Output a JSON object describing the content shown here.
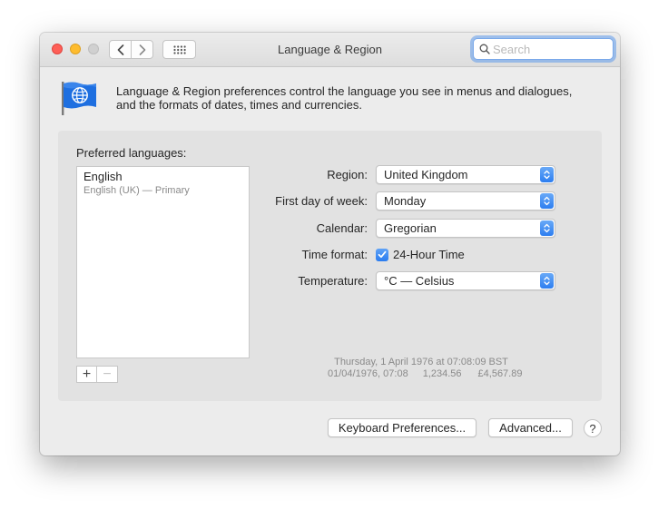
{
  "window": {
    "title": "Language & Region",
    "search_placeholder": "Search"
  },
  "description": {
    "line1": "Language & Region preferences control the language you see in menus and dialogues,",
    "line2": "and the formats of dates, times and currencies."
  },
  "preferred_languages": {
    "label": "Preferred languages:",
    "items": [
      {
        "name": "English",
        "subtitle": "English (UK) — Primary"
      }
    ],
    "add_label": "+",
    "remove_label": "−"
  },
  "settings": {
    "region": {
      "label": "Region:",
      "value": "United Kingdom"
    },
    "first_day": {
      "label": "First day of week:",
      "value": "Monday"
    },
    "calendar": {
      "label": "Calendar:",
      "value": "Gregorian"
    },
    "time_format": {
      "label": "Time format:",
      "checkbox_label": "24-Hour Time",
      "checked": true
    },
    "temperature": {
      "label": "Temperature:",
      "value": "°C — Celsius"
    }
  },
  "sample": {
    "line1": "Thursday, 1 April 1976 at 07:08:09 BST",
    "date_short": "01/04/1976, 07:08",
    "number": "1,234.56",
    "currency": "£4,567.89"
  },
  "buttons": {
    "keyboard": "Keyboard Preferences...",
    "advanced": "Advanced...",
    "help": "?"
  },
  "colors": {
    "accent": "#2d7ef0",
    "close": "#fe5f57",
    "minimize": "#febc2e",
    "zoom_disabled": "#d0d0d0"
  }
}
